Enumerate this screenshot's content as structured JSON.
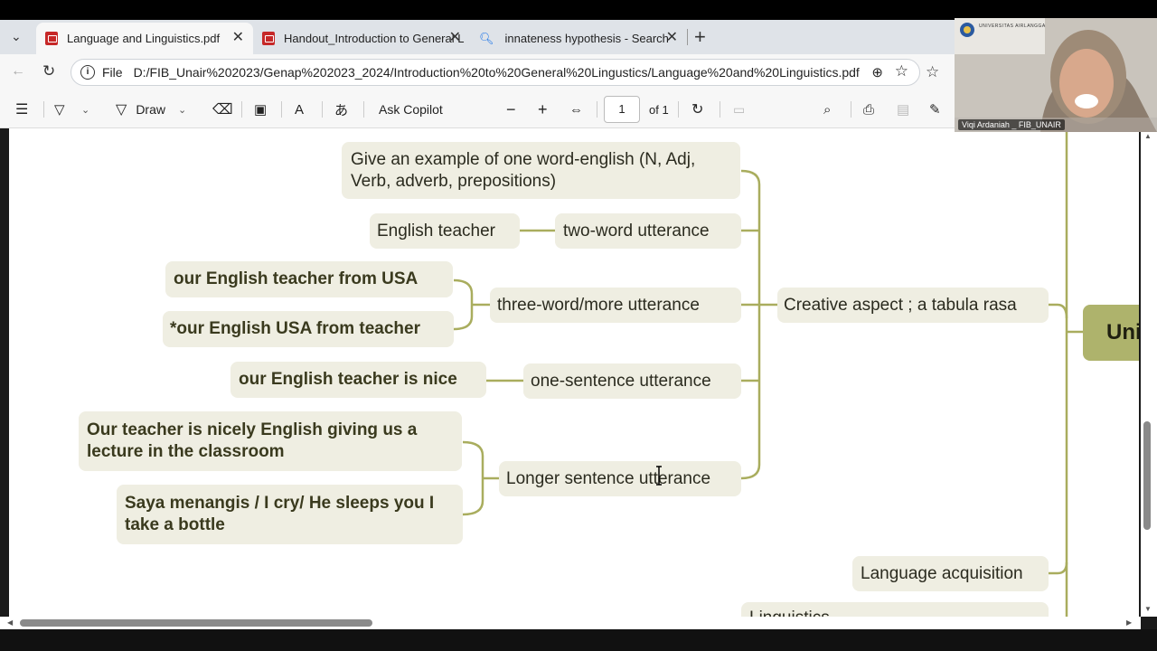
{
  "tabs": [
    {
      "label": "Language and Linguistics.pdf",
      "active": true
    },
    {
      "label": "Handout_Introduction to General L",
      "active": false
    },
    {
      "label": "innateness hypothesis - Search",
      "active": false
    }
  ],
  "address": {
    "scheme_label": "File",
    "url": "D:/FIB_Unair%202023/Genap%202023_2024/Introduction%20to%20General%20Lingustics/Language%20and%20Linguistics.pdf"
  },
  "toolbar": {
    "draw_label": "Draw",
    "copilot_label": "Ask Copilot",
    "page_current": "1",
    "page_total": "of 1"
  },
  "mindmap": {
    "root": "Uni",
    "creative": "Creative aspect ; a tabula rasa",
    "acquisition": "Language acquisition",
    "partial_bottom": "Linguistics...",
    "one_word": "Give an example of one word-english (N, Adj, Verb, adverb, prepositions)",
    "two_word": "two-word utterance",
    "two_word_example": "English teacher",
    "three_word": "three-word/more  utterance",
    "three_word_ex1": "our English teacher from USA",
    "three_word_ex2": "*our English USA from teacher",
    "one_sentence": "one-sentence utterance",
    "one_sentence_ex": "our English teacher is nice",
    "longer": "Longer sentence utterance",
    "longer_ex1": "Our teacher is nicely  English giving us a lecture in the classroom",
    "longer_ex2": "Saya menangis / I cry/ He sleeps you I take a bottle"
  },
  "webcam": {
    "name": "Viqi Ardaniah _ FIB_UNAIR",
    "logo_text": "UNIVERSITAS AIRLANGGA"
  },
  "colors": {
    "node_bg": "#efeee2",
    "connector": "#a9ad5e",
    "root_bg": "#aeb36c"
  }
}
